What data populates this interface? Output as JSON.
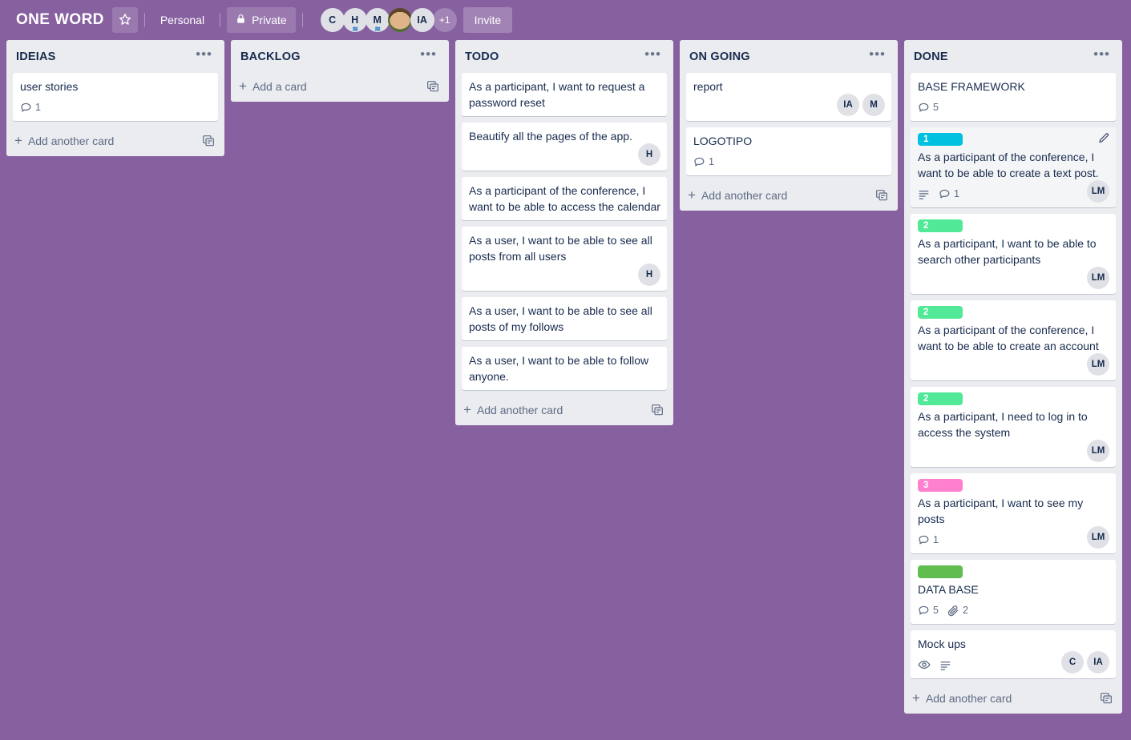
{
  "header": {
    "board_title": "ONE WORD",
    "star_icon": "star-icon",
    "workspace": "Personal",
    "visibility": "Private",
    "lock_icon": "lock-icon",
    "invite_label": "Invite",
    "avatars": [
      {
        "initials": "C",
        "type": "initials"
      },
      {
        "initials": "H",
        "type": "initials",
        "wave": true
      },
      {
        "initials": "M",
        "type": "initials",
        "wave": true
      },
      {
        "initials": "",
        "type": "photo"
      },
      {
        "initials": "IA",
        "type": "initials"
      },
      {
        "initials": "+1",
        "type": "more"
      }
    ]
  },
  "colors": {
    "board_background": "#8760a0",
    "list_background": "#ebecf0",
    "card_background": "#ffffff",
    "text_primary": "#172b4d",
    "text_muted": "#5e6c84",
    "label_cyan": "#00c2e0",
    "label_mint": "#51e898",
    "label_green": "#61bd4f",
    "label_pink": "#ff80ce"
  },
  "lists": [
    {
      "title": "IDEIAS",
      "menu_icon": "list-menu-icon",
      "add_card_label": "Add another card",
      "template_icon": "card-template-icon",
      "cards": [
        {
          "title": "user stories",
          "labels": [],
          "badges": [
            {
              "icon": "comment-icon",
              "value": "1"
            }
          ],
          "members": []
        }
      ]
    },
    {
      "title": "BACKLOG",
      "menu_icon": "list-menu-icon",
      "add_card_label": "Add a card",
      "template_icon": "card-template-icon",
      "cards": []
    },
    {
      "title": "TODO",
      "menu_icon": "list-menu-icon",
      "add_card_label": "Add another card",
      "template_icon": "card-template-icon",
      "cards": [
        {
          "title": "As a participant, I want to request a password reset",
          "labels": [],
          "badges": [],
          "members": []
        },
        {
          "title": "Beautify all the pages of the app.",
          "labels": [],
          "badges": [],
          "members": [
            {
              "initials": "H"
            }
          ]
        },
        {
          "title": "As a participant of the conference, I want to be able to access the calendar",
          "labels": [],
          "badges": [],
          "members": []
        },
        {
          "title": "As a user, I want to be able to see all posts from all users",
          "labels": [],
          "badges": [],
          "members": [
            {
              "initials": "H"
            }
          ]
        },
        {
          "title": "As a user, I want to be able to see all posts of my follows",
          "labels": [],
          "badges": [],
          "members": []
        },
        {
          "title": "As a user, I want to be able to follow anyone.",
          "labels": [],
          "badges": [],
          "members": []
        }
      ]
    },
    {
      "title": "ON GOING",
      "menu_icon": "list-menu-icon",
      "add_card_label": "Add another card",
      "template_icon": "card-template-icon",
      "cards": [
        {
          "title": "report",
          "labels": [],
          "badges": [],
          "members": [
            {
              "initials": "IA"
            },
            {
              "initials": "M"
            }
          ]
        },
        {
          "title": "LOGOTIPO",
          "labels": [],
          "badges": [
            {
              "icon": "comment-icon",
              "value": "1"
            }
          ],
          "members": []
        }
      ]
    },
    {
      "title": "DONE",
      "menu_icon": "list-menu-icon",
      "add_card_label": "Add another card",
      "template_icon": "card-template-icon",
      "cards": [
        {
          "title": "BASE FRAMEWORK",
          "labels": [],
          "badges": [
            {
              "icon": "comment-icon",
              "value": "5"
            }
          ],
          "members": []
        },
        {
          "title": "As a participant of the conference, I want to be able to create a text post.",
          "labels": [
            {
              "text": "1",
              "color": "#00c2e0"
            }
          ],
          "badges": [
            {
              "icon": "description-icon",
              "value": ""
            },
            {
              "icon": "comment-icon",
              "value": "1"
            }
          ],
          "members": [
            {
              "initials": "LM"
            }
          ],
          "hovered": true,
          "edit_icon": "edit-pencil-icon"
        },
        {
          "title": "As a participant, I want to be able to search other participants",
          "labels": [
            {
              "text": "2",
              "color": "#51e898"
            }
          ],
          "badges": [],
          "members": [
            {
              "initials": "LM"
            }
          ]
        },
        {
          "title": "As a participant of the conference, I want to be able to create an account",
          "labels": [
            {
              "text": "2",
              "color": "#51e898"
            }
          ],
          "badges": [],
          "members": [
            {
              "initials": "LM"
            }
          ]
        },
        {
          "title": "As a participant, I need to log in to access the system",
          "labels": [
            {
              "text": "2",
              "color": "#51e898"
            }
          ],
          "badges": [],
          "members": [
            {
              "initials": "LM"
            }
          ]
        },
        {
          "title": "As a participant, I want to see my posts",
          "labels": [
            {
              "text": "3",
              "color": "#ff80ce"
            }
          ],
          "badges": [
            {
              "icon": "comment-icon",
              "value": "1"
            }
          ],
          "members": [
            {
              "initials": "LM"
            }
          ]
        },
        {
          "title": "DATA BASE",
          "labels": [
            {
              "text": "",
              "color": "#61bd4f"
            }
          ],
          "badges": [
            {
              "icon": "comment-icon",
              "value": "5"
            },
            {
              "icon": "attachment-icon",
              "value": "2"
            }
          ],
          "members": []
        },
        {
          "title": "Mock ups",
          "labels": [],
          "badges": [
            {
              "icon": "watch-eye-icon",
              "value": ""
            },
            {
              "icon": "description-icon",
              "value": ""
            }
          ],
          "members": [
            {
              "initials": "C"
            },
            {
              "initials": "IA"
            }
          ]
        }
      ]
    }
  ]
}
